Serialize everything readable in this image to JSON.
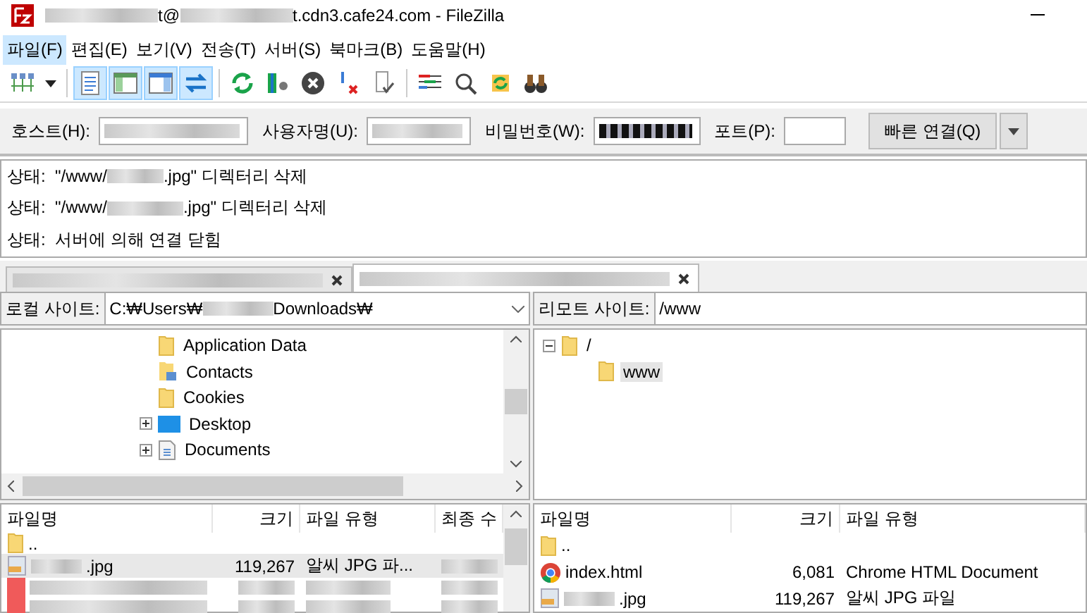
{
  "window": {
    "title": [
      {
        "kind": "redacted"
      },
      {
        "kind": "text",
        "text": "t@"
      },
      {
        "kind": "redacted"
      },
      {
        "kind": "text",
        "text": "t.cdn3.cafe24.com - FileZilla"
      }
    ]
  },
  "menu": [
    {
      "label": "파일(F)",
      "selected": true
    },
    {
      "label": "편집(E)",
      "selected": false
    },
    {
      "label": "보기(V)",
      "selected": false
    },
    {
      "label": "전송(T)",
      "selected": false
    },
    {
      "label": "서버(S)",
      "selected": false
    },
    {
      "label": "북마크(B)",
      "selected": false
    },
    {
      "label": "도움말(H)",
      "selected": false
    }
  ],
  "toolbar": [
    {
      "kind": "sitemanager",
      "on": false
    },
    {
      "kind": "caret",
      "on": false
    },
    {
      "kind": "sep"
    },
    {
      "kind": "log",
      "on": true
    },
    {
      "kind": "localtree",
      "on": true
    },
    {
      "kind": "remotetree",
      "on": true
    },
    {
      "kind": "queue",
      "on": true
    },
    {
      "kind": "sep"
    },
    {
      "kind": "refresh",
      "on": false
    },
    {
      "kind": "process",
      "on": false
    },
    {
      "kind": "cancel",
      "on": false
    },
    {
      "kind": "disconnect",
      "on": false
    },
    {
      "kind": "reconnect",
      "on": false
    },
    {
      "kind": "sep"
    },
    {
      "kind": "filter",
      "on": false
    },
    {
      "kind": "search",
      "on": false
    },
    {
      "kind": "sync",
      "on": false
    },
    {
      "kind": "binoculars",
      "on": false
    }
  ],
  "quickconnect": {
    "fields": [
      {
        "label": "호스트(H):",
        "kind": "redacted"
      },
      {
        "label": "사용자명(U):",
        "kind": "redacted"
      },
      {
        "label": "비밀번호(W):",
        "kind": "password"
      },
      {
        "label": "포트(P):",
        "kind": "empty"
      }
    ],
    "button": "빠른 연결(Q)"
  },
  "log": [
    {
      "segments": [
        {
          "kind": "text",
          "text": "상태:  \"/www/"
        },
        {
          "kind": "redacted"
        },
        {
          "kind": "text",
          "text": ".jpg\" 디렉터리 삭제"
        }
      ]
    },
    {
      "segments": [
        {
          "kind": "text",
          "text": "상태:  \"/www/"
        },
        {
          "kind": "redacted"
        },
        {
          "kind": "text",
          "text": ".jpg\" 디렉터리 삭제"
        }
      ]
    },
    {
      "segments": [
        {
          "kind": "text",
          "text": "상태:  서버에 의해 연결 닫힘"
        }
      ]
    }
  ],
  "tabs": [
    {
      "selected": false
    },
    {
      "selected": true
    }
  ],
  "local": {
    "label": "로컬 사이트:",
    "path": [
      {
        "kind": "text",
        "text": "C:₩Users₩"
      },
      {
        "kind": "redacted"
      },
      {
        "kind": "text",
        "text": "Downloads₩"
      }
    ],
    "tree": [
      {
        "name": "Application Data",
        "kind": "folder",
        "expander": false
      },
      {
        "name": "Contacts",
        "kind": "contacts",
        "expander": false
      },
      {
        "name": "Cookies",
        "kind": "folder",
        "expander": false
      },
      {
        "name": "Desktop",
        "kind": "desktop",
        "expander": true
      },
      {
        "name": "Documents",
        "kind": "documents",
        "expander": true
      }
    ],
    "columns": [
      "파일명",
      "크기",
      "파일 유형",
      "최종 수"
    ],
    "files": [
      {
        "kind": "folder",
        "name": [
          {
            "kind": "text",
            "text": ".."
          }
        ],
        "selected": false,
        "redacted_date": false
      },
      {
        "kind": "jpg",
        "name": [
          {
            "kind": "redacted"
          },
          {
            "kind": "text",
            "text": ".jpg"
          }
        ],
        "size": "119,267",
        "type": "알씨 JPG 파...",
        "selected": true,
        "redacted_date": true
      },
      {
        "kind": "blurred",
        "name": [
          {
            "kind": "redacted"
          }
        ],
        "selected": false,
        "redacted_date": true
      },
      {
        "kind": "blurred",
        "name": [
          {
            "kind": "redacted"
          }
        ],
        "selected": false,
        "redacted_date": true
      }
    ]
  },
  "remote": {
    "label": "리모트 사이트:",
    "path": "/www",
    "tree": [
      {
        "name": "/",
        "expanded": true,
        "selected": false,
        "children": [
          {
            "name": "www",
            "selected": true
          }
        ]
      }
    ],
    "columns": [
      "파일명",
      "크기",
      "파일 유형"
    ],
    "files": [
      {
        "kind": "folder",
        "name": [
          {
            "kind": "text",
            "text": ".."
          }
        ],
        "selected": false
      },
      {
        "kind": "chrome",
        "name": [
          {
            "kind": "text",
            "text": "index.html"
          }
        ],
        "size": "6,081",
        "type": "Chrome HTML Document",
        "selected": false
      },
      {
        "kind": "jpg",
        "name": [
          {
            "kind": "redacted"
          },
          {
            "kind": "text",
            "text": ".jpg"
          }
        ],
        "size": "119,267",
        "type": "알씨 JPG 파일",
        "selected": false
      }
    ]
  }
}
